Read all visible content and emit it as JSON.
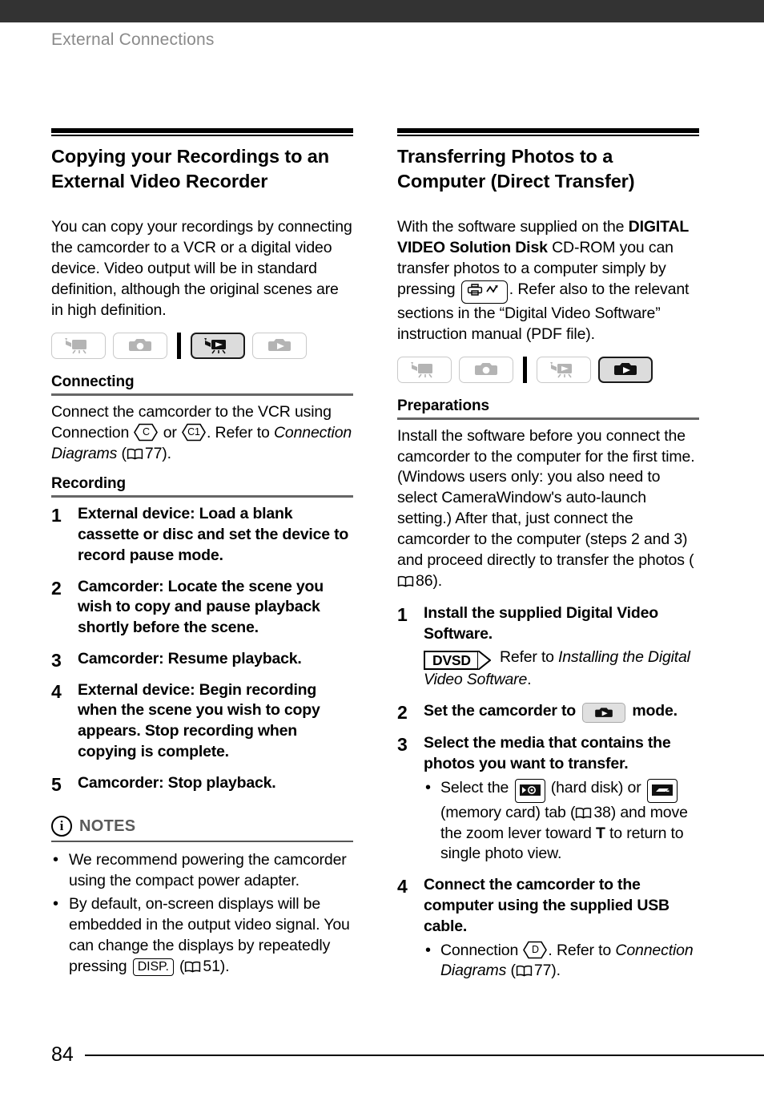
{
  "page": {
    "running_head": "External Connections",
    "page_number": "84"
  },
  "left_column": {
    "title": "Copying your Recordings to an External Video Recorder",
    "intro": "You can copy your recordings by connecting the camcorder to a VCR or a digital video device. Video output will be in standard definition, although the original scenes are in high definition.",
    "mode_icons": [
      {
        "name": "camcorder-record-mode-icon",
        "active": false
      },
      {
        "name": "photo-record-mode-icon",
        "active": false
      },
      {
        "name": "video-playback-mode-icon",
        "active": true
      },
      {
        "name": "photo-playback-mode-icon",
        "active": false
      }
    ],
    "connecting": {
      "heading": "Connecting",
      "text_a": "Connect the camcorder to the VCR using Connection ",
      "badge_c": "C",
      "text_b": " or ",
      "badge_c1": "C1",
      "text_c": ". Refer to ",
      "italic_ref": "Connection Diagrams",
      "text_d": " (",
      "page_ref": "77",
      "text_e": ")."
    },
    "recording": {
      "heading": "Recording",
      "steps": [
        {
          "num": "1",
          "text": "External device: Load a blank cassette or disc and set the device to record pause mode."
        },
        {
          "num": "2",
          "text": "Camcorder: Locate the scene you wish to copy and pause playback shortly before the scene."
        },
        {
          "num": "3",
          "text": "Camcorder: Resume playback."
        },
        {
          "num": "4",
          "text": "External device: Begin recording when the scene you wish to copy appears. Stop recording when copying is complete."
        },
        {
          "num": "5",
          "text": "Camcorder: Stop playback."
        }
      ]
    },
    "notes": {
      "icon_letter": "i",
      "label": "NOTES",
      "item1": "We recommend powering the camcorder using the compact power adapter.",
      "item2_a": "By default, on-screen displays will be embedded in the output video signal. You can change the displays by repeatedly pressing ",
      "item2_key": "DISP.",
      "item2_b": " (",
      "item2_page": "51",
      "item2_c": ")."
    }
  },
  "right_column": {
    "title": "Transferring Photos to a Computer (Direct Transfer)",
    "intro_a": "With the software supplied on the ",
    "intro_bold": "DIGITAL VIDEO Solution Disk",
    "intro_b": " CD-ROM you can transfer photos to a computer simply by pressing ",
    "intro_c": ". Refer also to the relevant sections in the “Digital Video Software” instruction manual (PDF file).",
    "mode_icons": [
      {
        "name": "camcorder-record-mode-icon",
        "active": false
      },
      {
        "name": "photo-record-mode-icon",
        "active": false
      },
      {
        "name": "video-playback-mode-icon",
        "active": false
      },
      {
        "name": "photo-playback-mode-icon",
        "active": true
      }
    ],
    "preparations": {
      "heading": "Preparations",
      "text_a": "Install the software before you connect the camcorder to the computer for the first time. (Windows users only: you also need to select CameraWindow's auto-launch setting.) After that, just connect the camcorder to the computer (steps 2 and 3) and proceed directly to transfer the photos (",
      "page_ref": "86",
      "text_b": ")."
    },
    "steps": {
      "step1": {
        "num": "1",
        "text": "Install the supplied Digital Video Software.",
        "tag": "DVSD",
        "sub_a": " Refer to ",
        "sub_italic": "Installing the Digital Video Software",
        "sub_b": "."
      },
      "step2": {
        "num": "2",
        "text_a": "Set the camcorder to ",
        "text_b": " mode."
      },
      "step3": {
        "num": "3",
        "text": "Select the media that contains the photos you want to transfer.",
        "bullet_a": "Select the ",
        "bullet_b": " (hard disk) or ",
        "bullet_c": " (memory card) tab (",
        "bullet_page": "38",
        "bullet_d": ") and move the zoom lever toward ",
        "bullet_t": "T",
        "bullet_e": " to return to single photo view."
      },
      "step4": {
        "num": "4",
        "text": "Connect the camcorder to the computer using the supplied USB cable.",
        "bullet_a": "Connection ",
        "badge_d": "D",
        "bullet_b": ". Refer to ",
        "bullet_italic": "Connection Diagrams",
        "bullet_c": " (",
        "bullet_page": "77",
        "bullet_d": ")."
      }
    }
  },
  "colors": {
    "header_bar": "#333333",
    "running_head": "#8a8a8a",
    "rule": "#000000",
    "sub_rule": "#666666",
    "notes_label": "#5a5a5a",
    "mode_inactive": "#c9c9c9",
    "mode_active_bg": "#dcdcdc"
  }
}
